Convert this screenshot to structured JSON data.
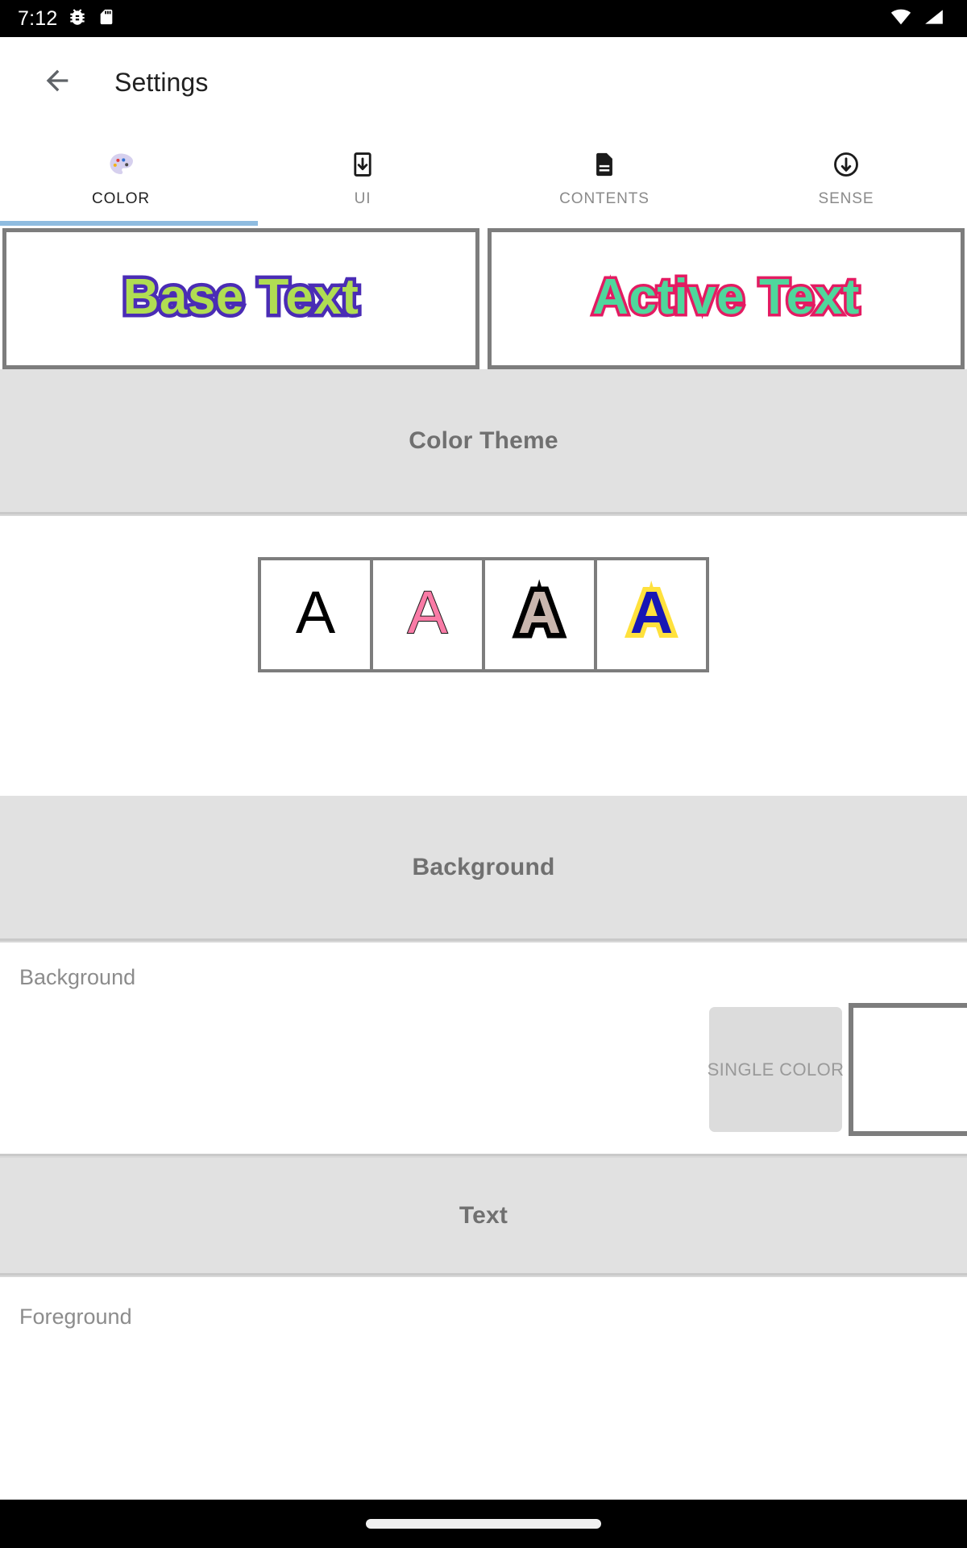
{
  "status_bar": {
    "time": "7:12",
    "left_icons": [
      "bug-icon",
      "sd-card-icon"
    ],
    "right_icons": [
      "wifi-icon",
      "cell-signal-icon"
    ],
    "background": "#000000"
  },
  "app_bar": {
    "back_icon": "arrow-back-icon",
    "title": "Settings"
  },
  "tabs": {
    "indicator_color": "#8fbce0",
    "items": [
      {
        "label": "COLOR",
        "icon": "palette-icon",
        "selected": true
      },
      {
        "label": "UI",
        "icon": "install-mobile-icon",
        "selected": false
      },
      {
        "label": "CONTENTS",
        "icon": "document-icon",
        "selected": false
      },
      {
        "label": "SENSE",
        "icon": "arrow-circle-down-icon",
        "selected": false
      }
    ]
  },
  "preview": {
    "base": {
      "text": "Base Text",
      "fill_color": "#b0dd52",
      "outline_color": "#4a2cb5"
    },
    "active": {
      "text": "Active Text",
      "fill_color": "#4fd79c",
      "outline_color": "#e31b62"
    }
  },
  "sections": {
    "color_theme": {
      "title": "Color Theme",
      "themes": [
        {
          "glyph": "A",
          "fill": "#000000",
          "outline": "none",
          "selected": false
        },
        {
          "glyph": "A",
          "fill": "#f97ba6",
          "outline": "#1a1a1a",
          "selected": false
        },
        {
          "glyph": "A",
          "fill": "#c9b6ae",
          "outline": "#000000",
          "selected": false
        },
        {
          "glyph": "A",
          "fill": "#1616b5",
          "outline": "#ffe13d",
          "selected": false
        }
      ]
    },
    "background": {
      "title": "Background",
      "row_label": "Background",
      "mode_button": "SINGLE COLOR",
      "swatch_color": "#ffffff"
    },
    "text": {
      "title": "Text",
      "row_label": "Foreground"
    }
  },
  "nav_bar": {
    "gesture_pill": "home-gesture-pill"
  }
}
